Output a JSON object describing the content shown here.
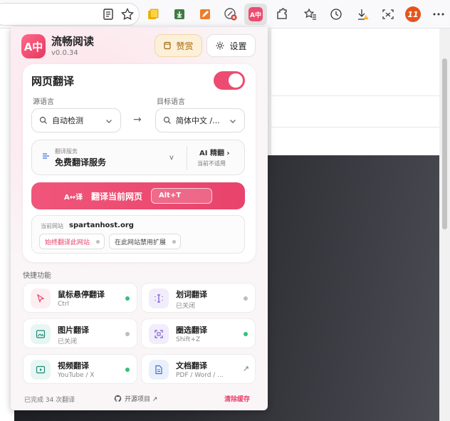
{
  "toolbar": {
    "icons": [
      "reader-view-icon",
      "favorite-star-icon",
      "extension-sticky-notes-icon",
      "extension-download-icon",
      "extension-pencil-icon",
      "extension-shield-blocked-icon",
      "extension-translator-icon",
      "extensions-puzzle-icon",
      "favorites-icon",
      "history-icon",
      "downloads-icon",
      "screenshot-icon",
      "profile-11-icon",
      "more-menu-icon"
    ],
    "profile_badge": "11",
    "translator_glyph": "A中"
  },
  "popup": {
    "app_name": "流畅阅读",
    "version": "v0.0.34",
    "logo_text": "A中",
    "donate_label": "赞赏",
    "settings_label": "设置"
  },
  "web_translate": {
    "title": "网页翻译",
    "enabled": true,
    "source_label": "源语言",
    "source_value": "自动检测",
    "arrow": "→",
    "target_label": "目标语言",
    "target_value": "简体中文 /...",
    "service_caption": "翻译服务",
    "service_value": "免费翻译服务",
    "service_chevron": "v",
    "ai_label": "AI 精翻 ›",
    "ai_status": "当前不适用",
    "translate_glyph": "A↔译",
    "translate_label": "翻译当前网页",
    "translate_shortcut": "Alt+T",
    "site_caption": "当前网站",
    "site_host": "spartanhost.org",
    "always_translate": "始终翻译此网站",
    "disable_on_site": "在此网站禁用扩展"
  },
  "quick": {
    "title": "快捷功能",
    "items": [
      {
        "title": "鼠标悬停翻译",
        "sub": "Ctrl",
        "status": "on"
      },
      {
        "title": "划词翻译",
        "sub": "已关闭",
        "status": "off"
      },
      {
        "title": "图片翻译",
        "sub": "已关闭",
        "status": "off"
      },
      {
        "title": "圈选翻译",
        "sub": "Shift+Z",
        "status": "on"
      },
      {
        "title": "视频翻译",
        "sub": "YouTube / X",
        "status": "on"
      },
      {
        "title": "文档翻译",
        "sub": "PDF / Word / ...",
        "status": "link"
      }
    ]
  },
  "footer": {
    "count_text": "已完成 34 次翻译",
    "open_source": "开源项目 ↗",
    "clear_cache": "清除缓存"
  },
  "colors": {
    "accent": "#e8436b",
    "status_on": "#35c07a",
    "status_off": "#bdbdbd"
  }
}
